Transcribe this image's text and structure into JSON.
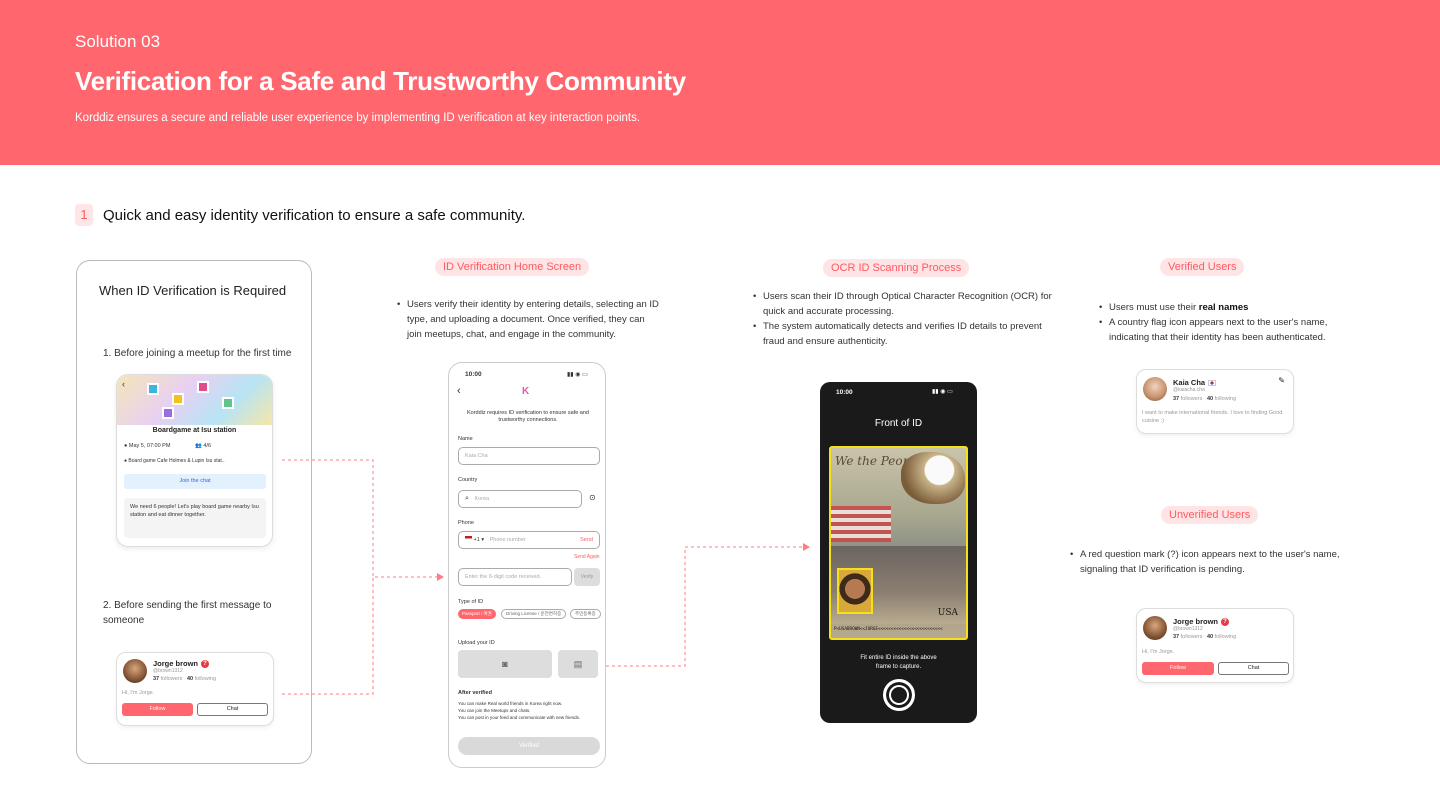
{
  "banner": {
    "kicker": "Solution 03",
    "title": "Verification for a Safe and Trustworthy Community",
    "subtitle": "Korddiz ensures a secure and reliable user experience by implementing ID verification at key interaction points."
  },
  "section": {
    "number": "1",
    "title": "Quick and easy identity verification to ensure a safe community."
  },
  "required": {
    "heading": "When ID Verification is Required",
    "step1": "1. Before joining a meetup for the first time",
    "step2": "2. Before sending the first message to someone",
    "meetup": {
      "title": "Boardgame at Isu station",
      "date": "May 5, 07:00 PM",
      "count": "4/6",
      "location": "Board game Cafe Holmes & Lupin Isu stat..",
      "join_label": "Join the chat",
      "description": "We need 6 people! Let's play board game nearby Isu station and eat dinner together."
    },
    "profile": {
      "name": "Jorge brown",
      "handle": "@brown1312",
      "followers": "37",
      "followers_label": "followers",
      "following": "40",
      "following_label": "following",
      "bio": "Hi, I'm Jorge.",
      "follow_label": "Follow",
      "chat_label": "Chat"
    }
  },
  "home": {
    "pill": "ID Verification Home Screen",
    "bullet": "Users verify their identity by entering details, selecting an ID type, and uploading a document. Once verified, they can join meetups, chat, and engage in the community.",
    "phone": {
      "time": "10:00",
      "back": "‹",
      "logo": "K",
      "intro": "Korddiz requires ID verification to ensure safe and trustworthy connections.",
      "name_label": "Name",
      "name_placeholder": "Kaia Cha",
      "country_label": "Country",
      "country_placeholder": "Korea",
      "phone_label": "Phone",
      "phone_code": "+1 ▾",
      "phone_placeholder": "Phone number",
      "send_label": "Send",
      "send_again": "Send Again",
      "code_placeholder": "Enter the 6-digit code received.",
      "verify_label": "Verify",
      "type_label": "Type of ID",
      "id_types": [
        "Passport / 여권",
        "Driving License / 운전면허증",
        "주민등록증"
      ],
      "upload_label": "Upload your ID",
      "after_label": "After verified",
      "after_items": [
        "You can make Real world friends in Korea right now.",
        "You can join the Meetups and chats.",
        "You can post in your feed and communicate with new friends."
      ],
      "verified_button": "Verified"
    }
  },
  "ocr": {
    "pill": "OCR ID Scanning Process",
    "bullets": [
      "Users scan their ID through Optical Character Recognition (OCR) for quick and accurate processing.",
      "The system automatically detects and verifies ID details to prevent fraud and ensure authenticity."
    ],
    "phone": {
      "time": "10:00",
      "title": "Front of ID",
      "passport_heading": "We the People",
      "passport_country": "USA",
      "mrz": "P<USABROWN<<JORGE<<<<<<<<<<<<<<<<<<<<<<<<<",
      "hint": "Fit entire ID inside the above frame to capture."
    }
  },
  "verified": {
    "pill": "Verified Users",
    "bullet_prefix": "Users must use their ",
    "bullet_bold": "real names",
    "bullet2": "A country flag icon appears next to the user's name, indicating that their identity has been authenticated.",
    "profile": {
      "name": "Kaia Cha",
      "handle": "@kaiacha.cha",
      "followers": "37",
      "followers_label": "followers",
      "following": "40",
      "following_label": "following",
      "bio": "I want to make international friends. I love to finding Good cuisine :)"
    }
  },
  "unverified": {
    "pill": "Unverified Users",
    "bullet": "A red question mark (?) icon appears next to the user's name, signaling that ID verification is pending.",
    "profile": {
      "name": "Jorge brown",
      "handle": "@brown1312",
      "followers": "37",
      "followers_label": "followers",
      "following": "40",
      "following_label": "following",
      "bio": "Hi, I'm Jorge.",
      "follow_label": "Follow",
      "chat_label": "Chat"
    }
  },
  "colors": {
    "accent": "#ff666d",
    "pill_bg": "#ffe4e5",
    "scan_frame": "#f4e01c"
  }
}
